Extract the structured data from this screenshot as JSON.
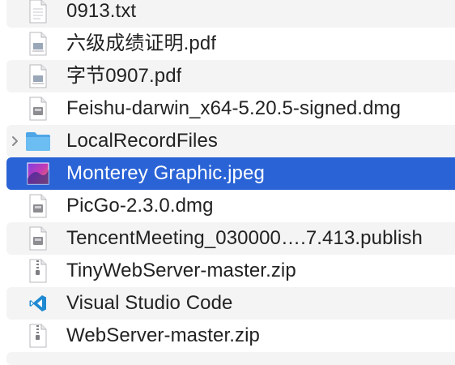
{
  "files": [
    {
      "label": "0913.txt",
      "icon": "text-file-icon",
      "type": "txt"
    },
    {
      "label": "六级成绩证明.pdf",
      "icon": "pdf-file-icon",
      "type": "pdf"
    },
    {
      "label": "字节0907.pdf",
      "icon": "pdf-file-icon",
      "type": "pdf"
    },
    {
      "label": "Feishu-darwin_x64-5.20.5-signed.dmg",
      "icon": "disk-image-icon",
      "type": "dmg"
    },
    {
      "label": "LocalRecordFiles",
      "icon": "folder-icon",
      "type": "folder"
    },
    {
      "label": "Monterey Graphic.jpeg",
      "icon": "image-file-icon",
      "type": "jpeg",
      "selected": true
    },
    {
      "label": "PicGo-2.3.0.dmg",
      "icon": "disk-image-icon",
      "type": "dmg"
    },
    {
      "label": "TencentMeeting_030000….7.413.publish",
      "icon": "disk-image-icon",
      "type": "dmg"
    },
    {
      "label": "TinyWebServer-master.zip",
      "icon": "zip-file-icon",
      "type": "zip"
    },
    {
      "label": "Visual Studio Code",
      "icon": "vscode-app-icon",
      "type": "app"
    },
    {
      "label": "WebServer-master.zip",
      "icon": "zip-file-icon",
      "type": "zip"
    }
  ],
  "colors": {
    "selection": "#2a63d6",
    "stripe": "#f4f4f5",
    "folder": "#5bb3ef",
    "vscode": "#1f8ad2"
  }
}
